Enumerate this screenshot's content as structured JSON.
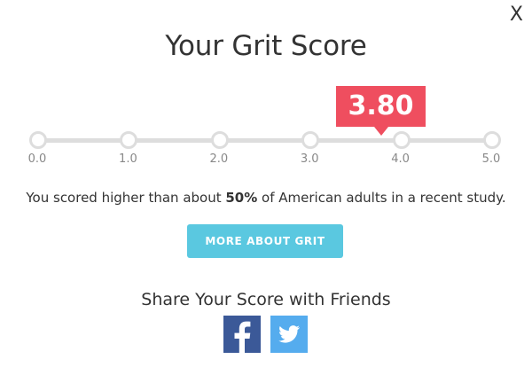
{
  "close": {
    "label": "X"
  },
  "title": "Your Grit Score",
  "score": {
    "value": 3.8,
    "display": "3.80"
  },
  "scale": {
    "min": 0,
    "max": 5,
    "ticks": [
      "0.0",
      "1.0",
      "2.0",
      "3.0",
      "4.0",
      "5.0"
    ]
  },
  "result": {
    "prefix": "You scored higher than about ",
    "percent": "50%",
    "suffix": " of American adults in a recent study."
  },
  "more_button": {
    "label": "MORE ABOUT GRIT"
  },
  "share": {
    "title": "Share Your Score with Friends",
    "facebook_icon": "facebook-icon",
    "twitter_icon": "twitter-icon"
  },
  "colors": {
    "accent": "#ef4e5f",
    "button": "#5ac8e0",
    "facebook": "#3b5998",
    "twitter": "#55acee",
    "track": "#dddddd"
  }
}
